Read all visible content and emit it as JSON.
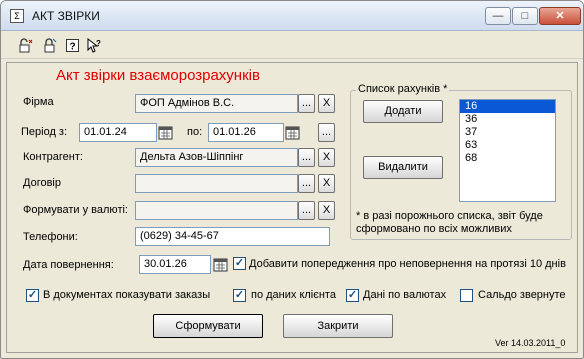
{
  "window": {
    "title": "АКТ ЗВІРКИ",
    "icon_glyph": "Σ",
    "minimize_glyph": "—",
    "maximize_glyph": "□",
    "close_glyph": "✕"
  },
  "toolbar": {
    "icons": [
      "open-lock-icon",
      "closed-lock-icon",
      "help-icon",
      "whats-this-icon"
    ]
  },
  "form": {
    "heading": "Акт звірки взаєморозрахунків",
    "firm_label": "Фірма",
    "firm_value": "ФОП Адмінов В.С.",
    "period_from_label": "Період з:",
    "period_from_value": "01.01.24",
    "period_to_label": "по:",
    "period_to_value": "01.01.26",
    "counterparty_label": "Контрагент:",
    "counterparty_value": "Дельта Азов-Шіппінг",
    "contract_label": "Договір",
    "contract_value": "",
    "currency_label": "Формувати у валюті:",
    "currency_value": "",
    "phones_label": "Телефони:",
    "phones_value": "(0629) 34-45-67",
    "return_date_label": "Дата повернення:",
    "return_date_value": "30.01.26",
    "ellipsis": "...",
    "clear": "X"
  },
  "accounts": {
    "group_title": "Список рахунків *",
    "add_label": "Додати",
    "remove_label": "Видалити",
    "items": [
      "16",
      "36",
      "37",
      "63",
      "68"
    ],
    "selected_index": 0,
    "note": "* в разі порожнього списка, звіт буде сформовано по всіх можливих"
  },
  "options": {
    "warning_label": "Добавити попередження про неповернення на протязі 10 днів",
    "warning_checked": true,
    "show_orders_label": "В документах показувати заказы",
    "show_orders_checked": true,
    "client_data_label": "по даних клієнта",
    "client_data_checked": true,
    "currency_data_label": "Дані по валютах",
    "currency_data_checked": true,
    "reverse_balance_label": "Сальдо звернуте",
    "reverse_balance_checked": false
  },
  "actions": {
    "generate_label": "Сформувати",
    "close_label": "Закрити"
  },
  "version": "Ver 14.03.2011_0"
}
